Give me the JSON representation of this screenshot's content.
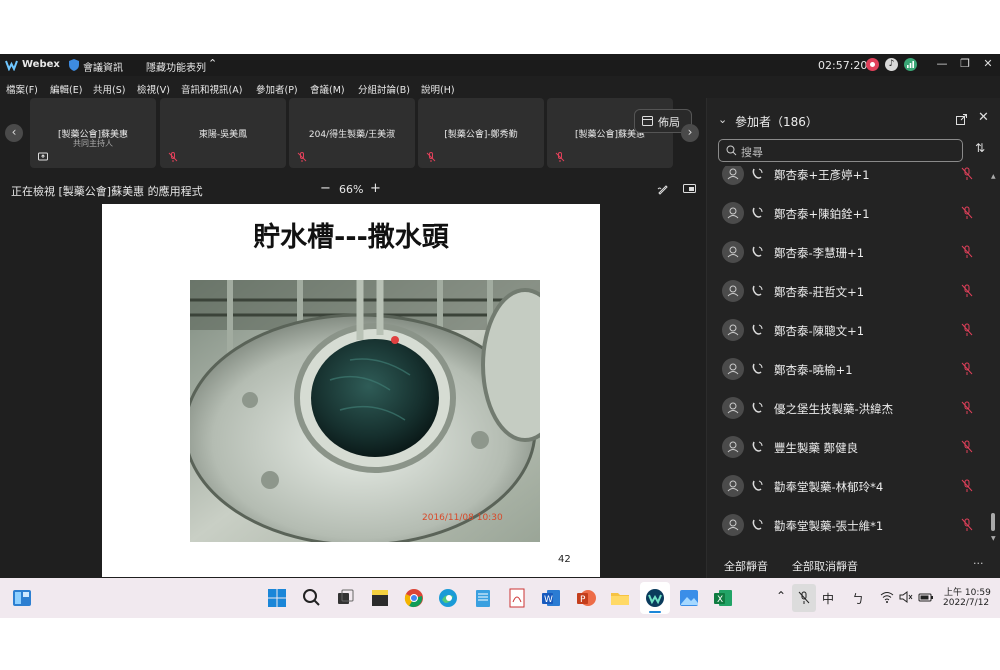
{
  "window": {
    "app_name": "Webex",
    "meeting_info": "會議資訊",
    "hidden_menu": "隱藏功能表列",
    "timer": "02:57:20"
  },
  "menu": [
    "檔案(F)",
    "編輯(E)",
    "共用(S)",
    "檢視(V)",
    "音訊和視訊(A)",
    "參加者(P)",
    "會議(M)",
    "分組討論(B)",
    "說明(H)"
  ],
  "video_strip": {
    "tiles": [
      {
        "name": "[製藥公會]蘇美惠",
        "sub": "共同主持人"
      },
      {
        "name": "東陽-吳美鳳",
        "sub": ""
      },
      {
        "name": "204/得生製藥/王美淑",
        "sub": ""
      },
      {
        "name": "[製藥公會]-鄭秀勤",
        "sub": ""
      },
      {
        "name": "[製藥公會]蘇美惠",
        "sub": ""
      }
    ],
    "layout_label": "佈局"
  },
  "view_bar": {
    "viewing_text": "正在檢視 [製藥公會]蘇美惠 的應用程式",
    "zoom": "66%",
    "minus": "−",
    "plus": "+"
  },
  "slide": {
    "title": "貯水槽---撒水頭",
    "photo_stamp": "2016/11/08  10:30",
    "page_number": "42"
  },
  "participants": {
    "header": "參加者（186）",
    "search_placeholder": "搜尋",
    "list": [
      "鄭杏泰+王彥婷+1",
      "鄭杏泰+陳鉑銓+1",
      "鄭杏泰-李慧珊+1",
      "鄭杏泰-莊哲文+1",
      "鄭杏泰-陳聰文+1",
      "鄭杏泰-曉榆+1",
      "優之堡生技製藥-洪緯杰",
      "豐生製藥 鄭健良",
      "勸奉堂製藥-林郁玲*4",
      "勸奉堂製藥-張士維*1"
    ],
    "mute_all": "全部靜音",
    "unmute_all": "全部取消靜音",
    "more": "..."
  },
  "taskbar": {
    "ime": "中",
    "time": "上午 10:59",
    "date": "2022/7/12"
  },
  "colors": {
    "accent_red": "#e0405a",
    "panel_bg": "#232323",
    "app_bg": "#1f1f1f"
  }
}
